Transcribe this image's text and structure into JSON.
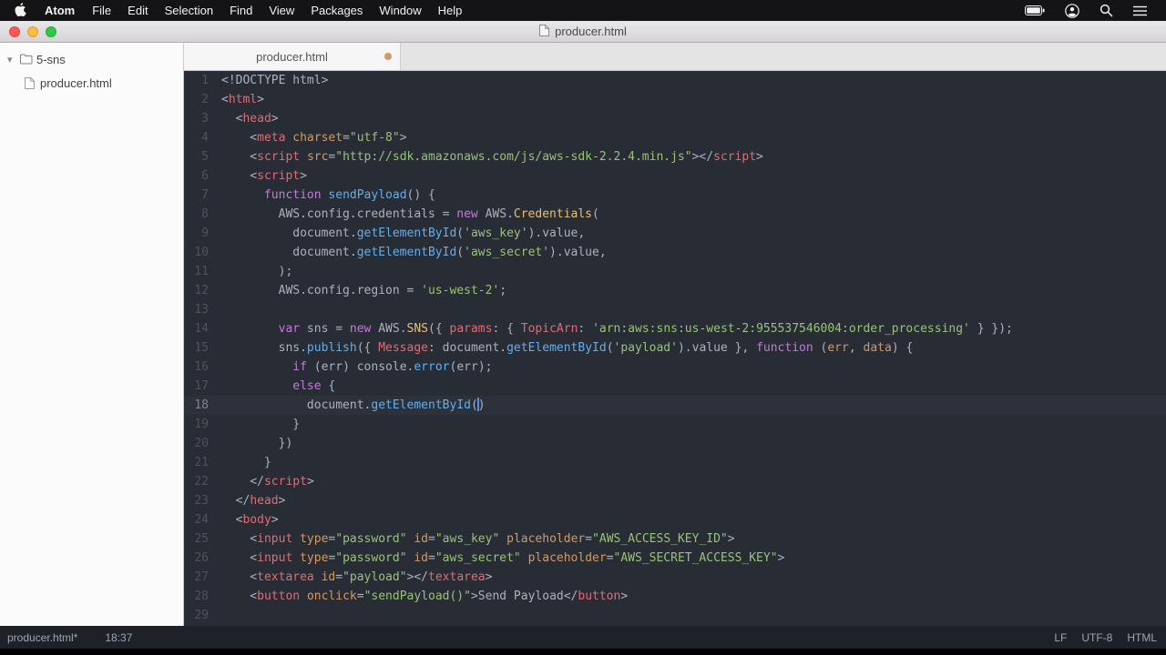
{
  "menu_bar": {
    "items": [
      "Atom",
      "File",
      "Edit",
      "Selection",
      "Find",
      "View",
      "Packages",
      "Window",
      "Help"
    ],
    "status_icons": [
      "battery-icon",
      "user-icon",
      "search-icon",
      "notification-center-icon"
    ]
  },
  "window": {
    "title": "producer.html"
  },
  "sidebar": {
    "folder": "5-sns",
    "files": [
      "producer.html"
    ]
  },
  "tabs": [
    {
      "label": "producer.html",
      "modified": true
    }
  ],
  "status_bar": {
    "file": "producer.html*",
    "position": "18:37",
    "line_ending": "LF",
    "encoding": "UTF-8",
    "language": "HTML"
  },
  "colors": {
    "editor_background": "#282c34",
    "active_line_background": "#2c323c",
    "cursor": "#528bff",
    "tab_modified_dot": "#d19a66",
    "menu_bar_background": "#141416",
    "status_text": "#9da5b4",
    "syntax": {
      "default": "#abb2bf",
      "tag": "#e06c75",
      "attribute": "#d19a66",
      "string": "#98c379",
      "keyword": "#c678dd",
      "function": "#61afef",
      "class": "#e5c07b"
    }
  },
  "editor": {
    "active_line": 18,
    "lines": [
      {
        "n": 1,
        "s": [
          [
            "d",
            "<!DOCTYPE html>"
          ]
        ]
      },
      {
        "n": 2,
        "s": [
          [
            "p",
            "<"
          ],
          [
            "t",
            "html"
          ],
          [
            "p",
            ">"
          ]
        ]
      },
      {
        "n": 3,
        "s": [
          [
            "p",
            "  <"
          ],
          [
            "t",
            "head"
          ],
          [
            "p",
            ">"
          ]
        ]
      },
      {
        "n": 4,
        "s": [
          [
            "p",
            "    <"
          ],
          [
            "t",
            "meta"
          ],
          [
            "d",
            " "
          ],
          [
            "a",
            "charset"
          ],
          [
            "p",
            "="
          ],
          [
            "s",
            "\"utf-8\""
          ],
          [
            "p",
            ">"
          ]
        ]
      },
      {
        "n": 5,
        "s": [
          [
            "p",
            "    <"
          ],
          [
            "t",
            "script"
          ],
          [
            "d",
            " "
          ],
          [
            "a",
            "src"
          ],
          [
            "p",
            "="
          ],
          [
            "s",
            "\"http://sdk.amazonaws.com/js/aws-sdk-2.2.4.min.js\""
          ],
          [
            "p",
            "></"
          ],
          [
            "t",
            "script"
          ],
          [
            "p",
            ">"
          ]
        ]
      },
      {
        "n": 6,
        "s": [
          [
            "p",
            "    <"
          ],
          [
            "t",
            "script"
          ],
          [
            "p",
            ">"
          ]
        ]
      },
      {
        "n": 7,
        "s": [
          [
            "d",
            "      "
          ],
          [
            "k",
            "function"
          ],
          [
            "d",
            " "
          ],
          [
            "f",
            "sendPayload"
          ],
          [
            "p",
            "() {"
          ]
        ]
      },
      {
        "n": 8,
        "s": [
          [
            "d",
            "        AWS.config.credentials = "
          ],
          [
            "k",
            "new"
          ],
          [
            "d",
            " AWS."
          ],
          [
            "y",
            "Credentials"
          ],
          [
            "p",
            "("
          ]
        ]
      },
      {
        "n": 9,
        "s": [
          [
            "d",
            "          document."
          ],
          [
            "f",
            "getElementById"
          ],
          [
            "p",
            "("
          ],
          [
            "s",
            "'aws_key'"
          ],
          [
            "p",
            ")."
          ],
          [
            "d",
            "value"
          ],
          [
            "p",
            ","
          ]
        ]
      },
      {
        "n": 10,
        "s": [
          [
            "d",
            "          document."
          ],
          [
            "f",
            "getElementById"
          ],
          [
            "p",
            "("
          ],
          [
            "s",
            "'aws_secret'"
          ],
          [
            "p",
            ")."
          ],
          [
            "d",
            "value"
          ],
          [
            "p",
            ","
          ]
        ]
      },
      {
        "n": 11,
        "s": [
          [
            "p",
            "        );"
          ]
        ]
      },
      {
        "n": 12,
        "s": [
          [
            "d",
            "        AWS.config.region = "
          ],
          [
            "s",
            "'us-west-2'"
          ],
          [
            "p",
            ";"
          ]
        ]
      },
      {
        "n": 13,
        "s": []
      },
      {
        "n": 14,
        "s": [
          [
            "d",
            "        "
          ],
          [
            "k",
            "var"
          ],
          [
            "d",
            " sns = "
          ],
          [
            "k",
            "new"
          ],
          [
            "d",
            " AWS."
          ],
          [
            "y",
            "SNS"
          ],
          [
            "p",
            "({ "
          ],
          [
            "o",
            "params"
          ],
          [
            "p",
            ": { "
          ],
          [
            "o",
            "TopicArn"
          ],
          [
            "p",
            ": "
          ],
          [
            "s",
            "'arn:aws:sns:us-west-2:955537546004:order_processing'"
          ],
          [
            "p",
            " } });"
          ]
        ]
      },
      {
        "n": 15,
        "s": [
          [
            "d",
            "        sns."
          ],
          [
            "f",
            "publish"
          ],
          [
            "p",
            "({ "
          ],
          [
            "o",
            "Message"
          ],
          [
            "p",
            ": "
          ],
          [
            "d",
            "document."
          ],
          [
            "f",
            "getElementById"
          ],
          [
            "p",
            "("
          ],
          [
            "s",
            "'payload'"
          ],
          [
            "p",
            ")."
          ],
          [
            "d",
            "value"
          ],
          [
            "p",
            " }, "
          ],
          [
            "k",
            "function"
          ],
          [
            "d",
            " "
          ],
          [
            "p",
            "("
          ],
          [
            "a",
            "err"
          ],
          [
            "p",
            ", "
          ],
          [
            "a",
            "data"
          ],
          [
            "p",
            ") {"
          ]
        ]
      },
      {
        "n": 16,
        "s": [
          [
            "d",
            "          "
          ],
          [
            "k",
            "if"
          ],
          [
            "p",
            " ("
          ],
          [
            "d",
            "err"
          ],
          [
            "p",
            ") "
          ],
          [
            "d",
            "console."
          ],
          [
            "f",
            "error"
          ],
          [
            "p",
            "("
          ],
          [
            "d",
            "err"
          ],
          [
            "p",
            ");"
          ]
        ]
      },
      {
        "n": 17,
        "s": [
          [
            "d",
            "          "
          ],
          [
            "k",
            "else"
          ],
          [
            "p",
            " {"
          ]
        ]
      },
      {
        "n": 18,
        "s": [
          [
            "d",
            "            document."
          ],
          [
            "f",
            "getElementById"
          ],
          [
            "p",
            "("
          ],
          [
            "cur",
            ""
          ],
          [
            "p",
            ")"
          ]
        ]
      },
      {
        "n": 19,
        "s": [
          [
            "p",
            "          }"
          ]
        ]
      },
      {
        "n": 20,
        "s": [
          [
            "p",
            "        })"
          ]
        ]
      },
      {
        "n": 21,
        "s": [
          [
            "p",
            "      }"
          ]
        ]
      },
      {
        "n": 22,
        "s": [
          [
            "p",
            "    </"
          ],
          [
            "t",
            "script"
          ],
          [
            "p",
            ">"
          ]
        ]
      },
      {
        "n": 23,
        "s": [
          [
            "p",
            "  </"
          ],
          [
            "t",
            "head"
          ],
          [
            "p",
            ">"
          ]
        ]
      },
      {
        "n": 24,
        "s": [
          [
            "p",
            "  <"
          ],
          [
            "t",
            "body"
          ],
          [
            "p",
            ">"
          ]
        ]
      },
      {
        "n": 25,
        "s": [
          [
            "p",
            "    <"
          ],
          [
            "t",
            "input"
          ],
          [
            "d",
            " "
          ],
          [
            "a",
            "type"
          ],
          [
            "p",
            "="
          ],
          [
            "s",
            "\"password\""
          ],
          [
            "d",
            " "
          ],
          [
            "a",
            "id"
          ],
          [
            "p",
            "="
          ],
          [
            "s",
            "\"aws_key\""
          ],
          [
            "d",
            " "
          ],
          [
            "a",
            "placeholder"
          ],
          [
            "p",
            "="
          ],
          [
            "s",
            "\"AWS_ACCESS_KEY_ID\""
          ],
          [
            "p",
            ">"
          ]
        ]
      },
      {
        "n": 26,
        "s": [
          [
            "p",
            "    <"
          ],
          [
            "t",
            "input"
          ],
          [
            "d",
            " "
          ],
          [
            "a",
            "type"
          ],
          [
            "p",
            "="
          ],
          [
            "s",
            "\"password\""
          ],
          [
            "d",
            " "
          ],
          [
            "a",
            "id"
          ],
          [
            "p",
            "="
          ],
          [
            "s",
            "\"aws_secret\""
          ],
          [
            "d",
            " "
          ],
          [
            "a",
            "placeholder"
          ],
          [
            "p",
            "="
          ],
          [
            "s",
            "\"AWS_SECRET_ACCESS_KEY\""
          ],
          [
            "p",
            ">"
          ]
        ]
      },
      {
        "n": 27,
        "s": [
          [
            "p",
            "    <"
          ],
          [
            "t",
            "textarea"
          ],
          [
            "d",
            " "
          ],
          [
            "a",
            "id"
          ],
          [
            "p",
            "="
          ],
          [
            "s",
            "\"payload\""
          ],
          [
            "p",
            "></"
          ],
          [
            "t",
            "textarea"
          ],
          [
            "p",
            ">"
          ]
        ]
      },
      {
        "n": 28,
        "s": [
          [
            "p",
            "    <"
          ],
          [
            "t",
            "button"
          ],
          [
            "d",
            " "
          ],
          [
            "a",
            "onclick"
          ],
          [
            "p",
            "="
          ],
          [
            "s",
            "\"sendPayload()\""
          ],
          [
            "p",
            ">"
          ],
          [
            "d",
            "Send Payload"
          ],
          [
            "p",
            "</"
          ],
          [
            "t",
            "button"
          ],
          [
            "p",
            ">"
          ]
        ]
      },
      {
        "n": 29,
        "s": []
      }
    ]
  }
}
